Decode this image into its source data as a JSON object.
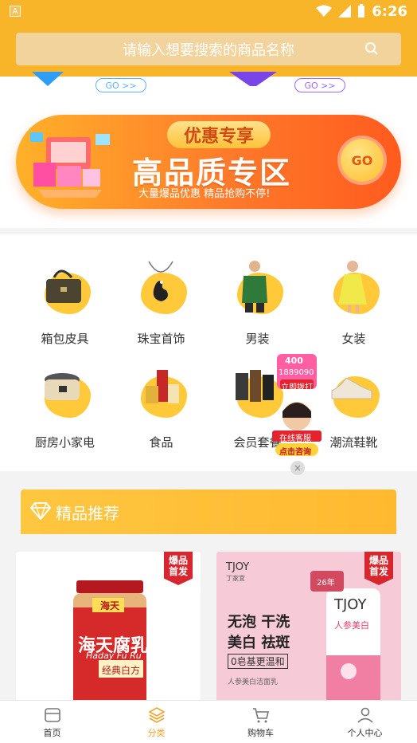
{
  "status_bar": {
    "time": "6:26",
    "left_glyph": "A"
  },
  "search": {
    "placeholder": "请输入想要搜索的商品名称"
  },
  "top_strip": {
    "go_left": "GO >>",
    "go_right": "GO >>"
  },
  "banner": {
    "tag": "优惠专享",
    "title": "高品质专区",
    "subtitle": "大量爆品优惠   精品抢购不停!",
    "go": "GO"
  },
  "categories": [
    {
      "label": "箱包皮具",
      "icon": "handbag-icon"
    },
    {
      "label": "珠宝首饰",
      "icon": "necklace-icon"
    },
    {
      "label": "男装",
      "icon": "menswear-icon"
    },
    {
      "label": "女装",
      "icon": "womenswear-icon"
    },
    {
      "label": "厨房小家电",
      "icon": "rice-cooker-icon"
    },
    {
      "label": "食品",
      "icon": "food-icon"
    },
    {
      "label": "会员套餐",
      "icon": "member-package-icon"
    },
    {
      "label": "潮流鞋靴",
      "icon": "shoes-icon"
    }
  ],
  "customer_service": {
    "phone_top": "400",
    "phone_mid": "1889090",
    "dial": "立即拨打",
    "online": "在线客服",
    "consult": "点击咨询",
    "close": "×"
  },
  "recommend": {
    "title": "精品推荐",
    "products": [
      {
        "badge_line1": "爆品",
        "badge_line2": "首发",
        "brand": "海天",
        "name": "海天腐乳",
        "pinyin": "Haday Fu Ru",
        "sub": "经典白方"
      },
      {
        "badge_line1": "爆品",
        "badge_line2": "首发",
        "brand": "TJOY",
        "brand_cn": "丁家宜",
        "line1": "无泡 干洗",
        "line2": "美白 祛斑",
        "line3": "0皂基更温和",
        "small": "人参美白洁面乳",
        "tube_brand": "TJOY",
        "tube_text": "人参美白",
        "seal": "26年"
      }
    ]
  },
  "tabbar": [
    {
      "label": "首页",
      "icon": "home-icon",
      "active": false
    },
    {
      "label": "分类",
      "icon": "category-icon",
      "active": true
    },
    {
      "label": "购物车",
      "icon": "cart-icon",
      "active": false
    },
    {
      "label": "个人中心",
      "icon": "user-icon",
      "active": false
    }
  ],
  "colors": {
    "accent": "#f8b52a",
    "active_tab": "#f3a32c",
    "badge_red": "#d8262e"
  }
}
